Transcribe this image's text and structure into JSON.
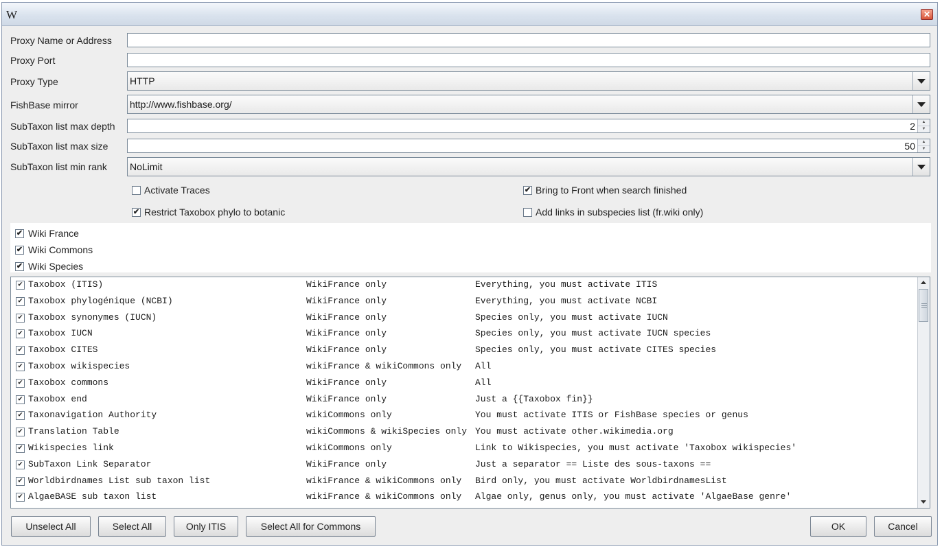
{
  "window": {
    "title": "W",
    "close_label": "✕"
  },
  "form": {
    "proxy_name_label": "Proxy Name or Address",
    "proxy_name_value": "",
    "proxy_port_label": "Proxy Port",
    "proxy_port_value": "",
    "proxy_type_label": "Proxy Type",
    "proxy_type_value": "HTTP",
    "fishbase_label": "FishBase mirror",
    "fishbase_value": "http://www.fishbase.org/",
    "depth_label": "SubTaxon list max depth",
    "depth_value": "2",
    "size_label": "SubTaxon list max size",
    "size_value": "50",
    "rank_label": "SubTaxon list min rank",
    "rank_value": "NoLimit"
  },
  "options": {
    "activate_traces": {
      "label": "Activate Traces",
      "checked": false
    },
    "bring_front": {
      "label": "Bring to Front when search finished",
      "checked": true
    },
    "restrict_taxobox": {
      "label": "Restrict Taxobox phylo to botanic",
      "checked": true
    },
    "add_links": {
      "label": "Add links in subspecies list (fr.wiki only)",
      "checked": false
    }
  },
  "wikis": [
    {
      "label": "Wiki France",
      "checked": true
    },
    {
      "label": "Wiki Commons",
      "checked": true
    },
    {
      "label": "Wiki Species",
      "checked": true
    }
  ],
  "check_mark": "✔",
  "list_rows": [
    {
      "name": "Taxobox (ITIS)",
      "scope": "WikiFrance only",
      "note": "Everything, you must activate ITIS",
      "checked": true
    },
    {
      "name": "Taxobox phylogénique (NCBI)",
      "scope": "WikiFrance only",
      "note": "Everything, you must activate NCBI",
      "checked": true
    },
    {
      "name": "Taxobox synonymes (IUCN)",
      "scope": "WikiFrance only",
      "note": "Species only, you must activate IUCN",
      "checked": true
    },
    {
      "name": "Taxobox IUCN",
      "scope": "WikiFrance only",
      "note": "Species only, you must activate IUCN species",
      "checked": true
    },
    {
      "name": "Taxobox CITES",
      "scope": "WikiFrance only",
      "note": "Species only, you must activate CITES species",
      "checked": true
    },
    {
      "name": "Taxobox wikispecies",
      "scope": "wikiFrance & wikiCommons only",
      "note": "All",
      "checked": true
    },
    {
      "name": "Taxobox commons",
      "scope": "WikiFrance only",
      "note": "All",
      "checked": true
    },
    {
      "name": "Taxobox end",
      "scope": "WikiFrance only",
      "note": "Just a {{Taxobox fin}}",
      "checked": true
    },
    {
      "name": "Taxonavigation Authority",
      "scope": "wikiCommons only",
      "note": "You must activate ITIS or FishBase species or genus",
      "checked": true
    },
    {
      "name": "Translation Table",
      "scope": "wikiCommons & wikiSpecies only",
      "note": "You must activate other.wikimedia.org",
      "checked": true
    },
    {
      "name": "Wikispecies link",
      "scope": "wikiCommons only",
      "note": "Link to Wikispecies, you must activate 'Taxobox wikispecies'",
      "checked": true
    },
    {
      "name": "SubTaxon Link Separator",
      "scope": "WikiFrance only",
      "note": "Just a separator == Liste des sous-taxons ==",
      "checked": true
    },
    {
      "name": "Worldbirdnames List sub taxon list",
      "scope": "wikiFrance & wikiCommons only",
      "note": "Bird only, you must activate WorldbirdnamesList",
      "checked": true
    },
    {
      "name": "AlgaeBASE sub taxon list",
      "scope": "wikiFrance & wikiCommons only",
      "note": "Algae only, genus only, you must activate 'AlgaeBase genre'",
      "checked": true
    }
  ],
  "buttons": {
    "unselect_all": "Unselect All",
    "select_all": "Select All",
    "only_itis": "Only ITIS",
    "select_commons": "Select All for Commons",
    "ok": "OK",
    "cancel": "Cancel"
  }
}
